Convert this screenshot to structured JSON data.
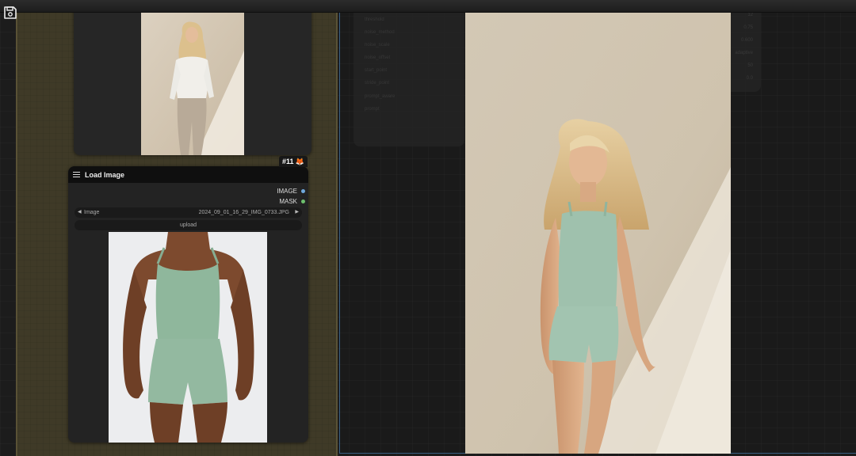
{
  "topbar": {
    "save_icon": "floppy-disk-icon"
  },
  "group": {
    "color": "#3f3a27"
  },
  "preview_node": {
    "image": "photo-woman-white-shirt-beige-trousers"
  },
  "load_image_node": {
    "badge": "#11",
    "badge_icon": "fox-icon",
    "title": "Load Image",
    "outputs": [
      {
        "label": "IMAGE",
        "color": "#6fa8dc"
      },
      {
        "label": "MASK",
        "color": "#6dbf6d"
      }
    ],
    "image_widget": {
      "label": "Image",
      "value": "2024_09_01_16_29_IMG_0733.JPG"
    },
    "upload_label": "upload",
    "image": "photo-model-green-tank-top-shorts"
  },
  "background_node": {
    "rows": [
      "threshold",
      "noise_method",
      "noise_scale",
      "noise_offset",
      "start_point",
      "stride_point",
      "prompt_aware",
      "prompt"
    ],
    "values": [
      "12",
      "0.75",
      "0.600",
      "adaptive",
      "50",
      "0.0"
    ]
  },
  "viewer": {
    "image": "photo-blonde-woman-green-tank-top-shorts"
  }
}
